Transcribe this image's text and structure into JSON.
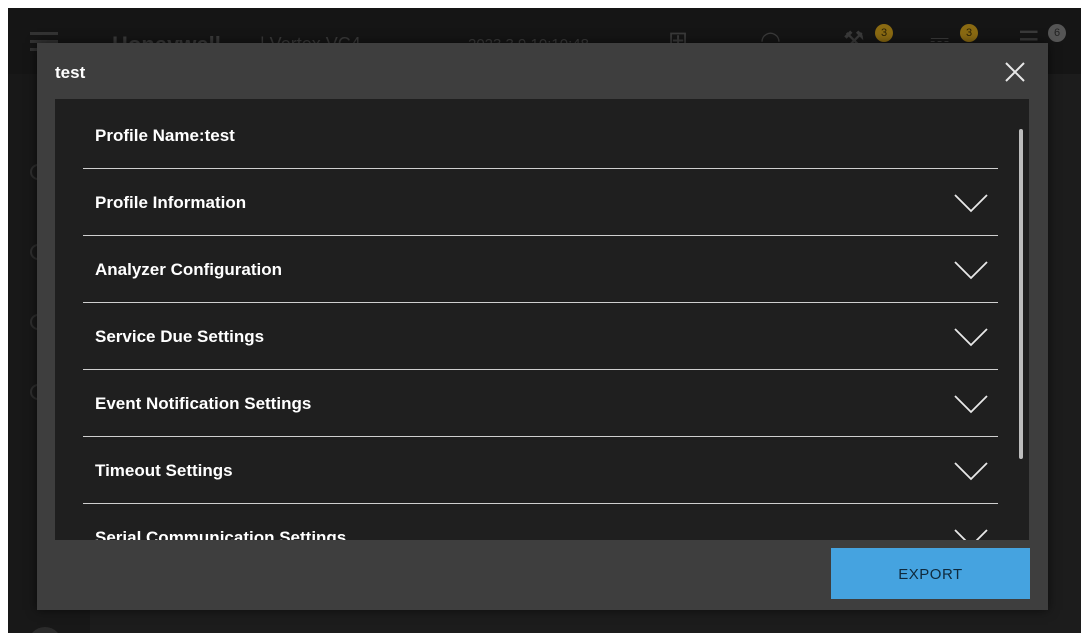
{
  "background": {
    "brand": "Honeywell",
    "product": "| Vertex VC4",
    "datetime": "2023.3.9 10:10:48",
    "badges": [
      "3",
      "3",
      "6"
    ]
  },
  "dialog": {
    "title": "test",
    "close_icon": "close-icon",
    "rows": [
      {
        "label": "Profile Name:test",
        "expandable": false
      },
      {
        "label": "Profile Information",
        "expandable": true
      },
      {
        "label": "Analyzer Configuration",
        "expandable": true
      },
      {
        "label": "Service Due Settings",
        "expandable": true
      },
      {
        "label": "Event Notification Settings",
        "expandable": true
      },
      {
        "label": "Timeout Settings",
        "expandable": true
      },
      {
        "label": "Serial Communication Settings",
        "expandable": true
      }
    ],
    "export_label": "EXPORT"
  },
  "colors": {
    "modal_bg": "#3e3e3e",
    "content_bg": "#1f1f1f",
    "accent": "#45a3e0",
    "divider": "#cfcfcf"
  }
}
